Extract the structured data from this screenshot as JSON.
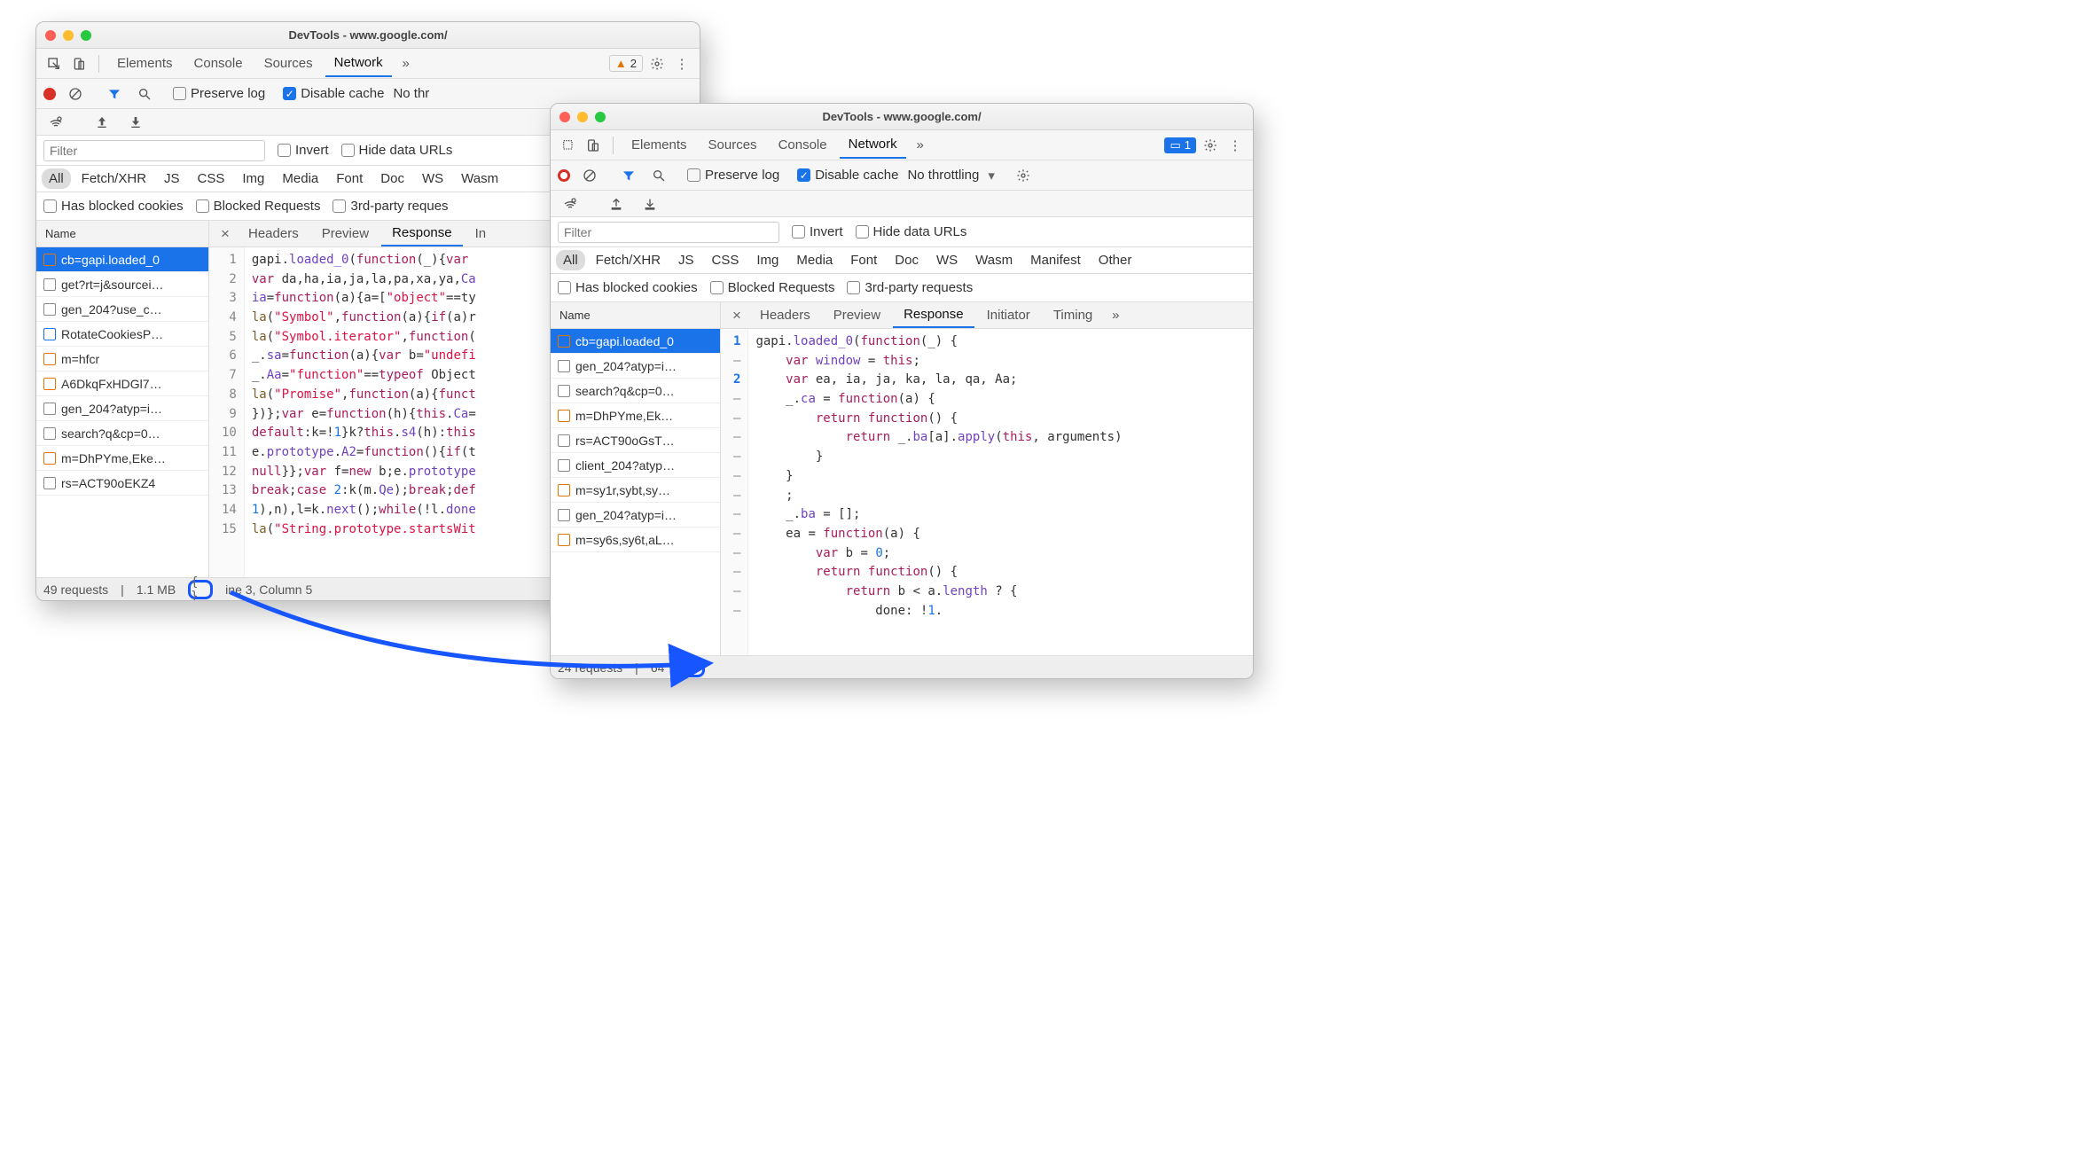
{
  "window1": {
    "title": "DevTools - www.google.com/",
    "tabs": {
      "elements": "Elements",
      "console": "Console",
      "sources": "Sources",
      "network": "Network"
    },
    "warnings": "2",
    "net": {
      "preserve": "Preserve log",
      "disablecache": "Disable cache",
      "throttling": "No thr"
    },
    "filter": {
      "placeholder": "Filter",
      "invert": "Invert",
      "hideurls": "Hide data URLs"
    },
    "types": [
      "All",
      "Fetch/XHR",
      "JS",
      "CSS",
      "Img",
      "Media",
      "Font",
      "Doc",
      "WS",
      "Wasm"
    ],
    "cookies": {
      "blocked": "Has blocked cookies",
      "breq": "Blocked Requests",
      "third": "3rd-party reques"
    },
    "name_hdr": "Name",
    "requests": [
      {
        "label": "cb=gapi.loaded_0",
        "icon": "or",
        "sel": true
      },
      {
        "label": "get?rt=j&sourcei…",
        "icon": ""
      },
      {
        "label": "gen_204?use_c…",
        "icon": ""
      },
      {
        "label": "RotateCookiesP…",
        "icon": "bl"
      },
      {
        "label": "m=hfcr",
        "icon": "or"
      },
      {
        "label": "A6DkqFxHDGl7…",
        "icon": "or"
      },
      {
        "label": "gen_204?atyp=i…",
        "icon": ""
      },
      {
        "label": "search?q&cp=0…",
        "icon": ""
      },
      {
        "label": "m=DhPYme,Eke…",
        "icon": "or"
      },
      {
        "label": "rs=ACT90oEKZ4",
        "icon": ""
      }
    ],
    "subtabs": {
      "headers": "Headers",
      "preview": "Preview",
      "response": "Response",
      "initiator": "In"
    },
    "gutter": [
      "1",
      "2",
      "3",
      "4",
      "5",
      "6",
      "7",
      "8",
      "9",
      "10",
      "11",
      "12",
      "13",
      "14",
      "15"
    ],
    "code_lines": [
      [
        {
          "t": "gapi"
        },
        {
          "t": "."
        },
        {
          "t": "loaded_0",
          "c": "k-id"
        },
        {
          "t": "("
        },
        {
          "t": "function",
          "c": "k-kw"
        },
        {
          "t": "(_){"
        },
        {
          "t": "var ",
          "c": "k-kw"
        }
      ],
      [
        {
          "t": "var ",
          "c": "k-kw"
        },
        {
          "t": "da,ha,ia,ja,la,pa,xa,ya,"
        },
        {
          "t": "Ca",
          "c": "k-id"
        }
      ],
      [
        {
          "t": "ia",
          "c": "k-id"
        },
        {
          "t": "="
        },
        {
          "t": "function",
          "c": "k-kw"
        },
        {
          "t": "(a){a=["
        },
        {
          "t": "\"object\"",
          "c": "k-str"
        },
        {
          "t": "==ty"
        }
      ],
      [
        {
          "t": "la",
          "c": "k-fn"
        },
        {
          "t": "("
        },
        {
          "t": "\"Symbol\"",
          "c": "k-str"
        },
        {
          "t": ","
        },
        {
          "t": "function",
          "c": "k-kw"
        },
        {
          "t": "(a){"
        },
        {
          "t": "if",
          "c": "k-kw"
        },
        {
          "t": "(a)r"
        }
      ],
      [
        {
          "t": "la",
          "c": "k-fn"
        },
        {
          "t": "("
        },
        {
          "t": "\"Symbol.iterator\"",
          "c": "k-str"
        },
        {
          "t": ","
        },
        {
          "t": "function",
          "c": "k-kw"
        },
        {
          "t": "("
        }
      ],
      [
        {
          "t": "_."
        },
        {
          "t": "sa",
          "c": "k-id"
        },
        {
          "t": "="
        },
        {
          "t": "function",
          "c": "k-kw"
        },
        {
          "t": "(a){"
        },
        {
          "t": "var ",
          "c": "k-kw"
        },
        {
          "t": "b="
        },
        {
          "t": "\"undefi",
          "c": "k-str"
        }
      ],
      [
        {
          "t": "_."
        },
        {
          "t": "Aa",
          "c": "k-id"
        },
        {
          "t": "="
        },
        {
          "t": "\"function\"",
          "c": "k-str"
        },
        {
          "t": "=="
        },
        {
          "t": "typeof ",
          "c": "k-kw"
        },
        {
          "t": "Object"
        }
      ],
      [
        {
          "t": "la",
          "c": "k-fn"
        },
        {
          "t": "("
        },
        {
          "t": "\"Promise\"",
          "c": "k-str"
        },
        {
          "t": ","
        },
        {
          "t": "function",
          "c": "k-kw"
        },
        {
          "t": "(a){"
        },
        {
          "t": "funct",
          "c": "k-kw"
        }
      ],
      [
        {
          "t": "})};"
        },
        {
          "t": "var ",
          "c": "k-kw"
        },
        {
          "t": "e="
        },
        {
          "t": "function",
          "c": "k-kw"
        },
        {
          "t": "(h){"
        },
        {
          "t": "this",
          "c": "k-kw"
        },
        {
          "t": "."
        },
        {
          "t": "Ca",
          "c": "k-id"
        },
        {
          "t": "="
        }
      ],
      [
        {
          "t": "default",
          "c": "k-kw"
        },
        {
          "t": ":k=!"
        },
        {
          "t": "1",
          "c": "k-num"
        },
        {
          "t": "}k?"
        },
        {
          "t": "this",
          "c": "k-kw"
        },
        {
          "t": "."
        },
        {
          "t": "s4",
          "c": "k-id"
        },
        {
          "t": "(h):"
        },
        {
          "t": "this",
          "c": "k-kw"
        }
      ],
      [
        {
          "t": "e."
        },
        {
          "t": "prototype",
          "c": "k-id"
        },
        {
          "t": "."
        },
        {
          "t": "A2",
          "c": "k-id"
        },
        {
          "t": "="
        },
        {
          "t": "function",
          "c": "k-kw"
        },
        {
          "t": "(){"
        },
        {
          "t": "if",
          "c": "k-kw"
        },
        {
          "t": "(t"
        }
      ],
      [
        {
          "t": "null",
          "c": "k-kw"
        },
        {
          "t": "}};"
        },
        {
          "t": "var ",
          "c": "k-kw"
        },
        {
          "t": "f="
        },
        {
          "t": "new ",
          "c": "k-kw"
        },
        {
          "t": "b;e."
        },
        {
          "t": "prototype",
          "c": "k-id"
        }
      ],
      [
        {
          "t": "break",
          "c": "k-kw"
        },
        {
          "t": ";"
        },
        {
          "t": "case ",
          "c": "k-kw"
        },
        {
          "t": "2",
          "c": "k-num"
        },
        {
          "t": ":k(m."
        },
        {
          "t": "Qe",
          "c": "k-id"
        },
        {
          "t": ");"
        },
        {
          "t": "break",
          "c": "k-kw"
        },
        {
          "t": ";"
        },
        {
          "t": "def",
          "c": "k-kw"
        }
      ],
      [
        {
          "t": "1",
          "c": "k-num"
        },
        {
          "t": "),n),l=k."
        },
        {
          "t": "next",
          "c": "k-id"
        },
        {
          "t": "();"
        },
        {
          "t": "while",
          "c": "k-kw"
        },
        {
          "t": "(!l."
        },
        {
          "t": "done",
          "c": "k-id"
        }
      ],
      [
        {
          "t": "la",
          "c": "k-fn"
        },
        {
          "t": "("
        },
        {
          "t": "\"String.prototype.startsWit",
          "c": "k-str"
        }
      ]
    ],
    "status": {
      "reqs": "49 requests",
      "size": "1.1 MB",
      "cursor": "ine 3, Column 5"
    }
  },
  "window2": {
    "title": "DevTools - www.google.com/",
    "tabs": {
      "elements": "Elements",
      "sources": "Sources",
      "console": "Console",
      "network": "Network"
    },
    "messages": "1",
    "net": {
      "preserve": "Preserve log",
      "disablecache": "Disable cache",
      "throttling": "No throttling"
    },
    "filter": {
      "placeholder": "Filter",
      "invert": "Invert",
      "hideurls": "Hide data URLs"
    },
    "types": [
      "All",
      "Fetch/XHR",
      "JS",
      "CSS",
      "Img",
      "Media",
      "Font",
      "Doc",
      "WS",
      "Wasm",
      "Manifest",
      "Other"
    ],
    "cookies": {
      "blocked": "Has blocked cookies",
      "breq": "Blocked Requests",
      "third": "3rd-party requests"
    },
    "name_hdr": "Name",
    "requests": [
      {
        "label": "cb=gapi.loaded_0",
        "icon": "or",
        "sel": true
      },
      {
        "label": "gen_204?atyp=i…",
        "icon": ""
      },
      {
        "label": "search?q&cp=0…",
        "icon": ""
      },
      {
        "label": "m=DhPYme,Ek…",
        "icon": "or"
      },
      {
        "label": "rs=ACT90oGsT…",
        "icon": ""
      },
      {
        "label": "client_204?atyp…",
        "icon": ""
      },
      {
        "label": "m=sy1r,sybt,sy…",
        "icon": "or"
      },
      {
        "label": "gen_204?atyp=i…",
        "icon": ""
      },
      {
        "label": "m=sy6s,sy6t,aL…",
        "icon": "or"
      }
    ],
    "subtabs": {
      "headers": "Headers",
      "preview": "Preview",
      "response": "Response",
      "initiator": "Initiator",
      "timing": "Timing"
    },
    "gutter": [
      "1",
      "–",
      "2",
      "–",
      "–",
      "–",
      "–",
      "–",
      "–",
      "–",
      "–",
      "–",
      "–",
      "–",
      "–"
    ],
    "gutter_bold": [
      0,
      2
    ],
    "code_lines": [
      [
        {
          "t": "gapi"
        },
        {
          "t": "."
        },
        {
          "t": "loaded_0",
          "c": "k-id"
        },
        {
          "t": "("
        },
        {
          "t": "function",
          "c": "k-kw"
        },
        {
          "t": "(_) {"
        }
      ],
      [
        {
          "t": "    "
        },
        {
          "t": "var ",
          "c": "k-kw"
        },
        {
          "t": "window",
          "c": "k-id"
        },
        {
          "t": " = "
        },
        {
          "t": "this",
          "c": "k-kw"
        },
        {
          "t": ";"
        }
      ],
      [
        {
          "t": "    "
        },
        {
          "t": "var ",
          "c": "k-kw"
        },
        {
          "t": "ea, ia, ja, ka, la, qa, Aa;"
        }
      ],
      [
        {
          "t": "    _."
        },
        {
          "t": "ca",
          "c": "k-id"
        },
        {
          "t": " = "
        },
        {
          "t": "function",
          "c": "k-kw"
        },
        {
          "t": "(a) {"
        }
      ],
      [
        {
          "t": "        "
        },
        {
          "t": "return ",
          "c": "k-kw"
        },
        {
          "t": "function",
          "c": "k-kw"
        },
        {
          "t": "() {"
        }
      ],
      [
        {
          "t": "            "
        },
        {
          "t": "return ",
          "c": "k-kw"
        },
        {
          "t": "_."
        },
        {
          "t": "ba",
          "c": "k-id"
        },
        {
          "t": "[a]."
        },
        {
          "t": "apply",
          "c": "k-id"
        },
        {
          "t": "("
        },
        {
          "t": "this",
          "c": "k-kw"
        },
        {
          "t": ", arguments)"
        }
      ],
      [
        {
          "t": "        }"
        }
      ],
      [
        {
          "t": "    }"
        }
      ],
      [
        {
          "t": "    ;"
        }
      ],
      [
        {
          "t": "    _."
        },
        {
          "t": "ba",
          "c": "k-id"
        },
        {
          "t": " = [];"
        }
      ],
      [
        {
          "t": "    ea = "
        },
        {
          "t": "function",
          "c": "k-kw"
        },
        {
          "t": "(a) {"
        }
      ],
      [
        {
          "t": "        "
        },
        {
          "t": "var ",
          "c": "k-kw"
        },
        {
          "t": "b = "
        },
        {
          "t": "0",
          "c": "k-num"
        },
        {
          "t": ";"
        }
      ],
      [
        {
          "t": "        "
        },
        {
          "t": "return ",
          "c": "k-kw"
        },
        {
          "t": "function",
          "c": "k-kw"
        },
        {
          "t": "() {"
        }
      ],
      [
        {
          "t": "            "
        },
        {
          "t": "return ",
          "c": "k-kw"
        },
        {
          "t": "b < a."
        },
        {
          "t": "length",
          "c": "k-id"
        },
        {
          "t": " ? {"
        }
      ],
      [
        {
          "t": "                done: !"
        },
        {
          "t": "1",
          "c": "k-num"
        },
        {
          "t": "."
        }
      ]
    ],
    "status": {
      "reqs": "24 requests",
      "size": "64"
    }
  }
}
